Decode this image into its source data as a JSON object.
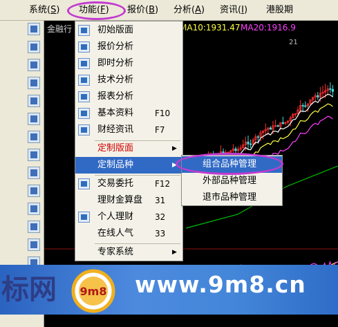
{
  "menubar": {
    "items": [
      {
        "label": "系统",
        "hotkey": "S"
      },
      {
        "label": "功能",
        "hotkey": "F"
      },
      {
        "label": "报价",
        "hotkey": "B"
      },
      {
        "label": "分析",
        "hotkey": "A"
      },
      {
        "label": "资讯",
        "hotkey": "I"
      },
      {
        "label": "港股期"
      }
    ]
  },
  "chart": {
    "stock_name": "金融行",
    "ma10": "MA10:1931.47",
    "ma20": "MA20:1916.9",
    "marker_label": "21",
    "colors": {
      "ma10": "#ffff40",
      "ma20": "#ff40ff",
      "up": "#ff3030",
      "down": "#40e0e0",
      "ma5": "#ffffff",
      "ma60": "#00c000"
    }
  },
  "menu": {
    "items": [
      {
        "label": "初始版面",
        "icon": "home-layout-icon"
      },
      {
        "label": "报价分析",
        "icon": "quote-list-icon"
      },
      {
        "label": "即时分析",
        "icon": "intraday-chart-icon"
      },
      {
        "label": "技术分析",
        "icon": "candlestick-icon"
      },
      {
        "label": "报表分析",
        "icon": "report-table-icon"
      },
      {
        "label": "基本资料",
        "shortcut": "F10",
        "icon": "profile-doc-icon"
      },
      {
        "label": "财经资讯",
        "shortcut": "F7",
        "icon": "news-icon"
      },
      {
        "label": "定制版面",
        "arrow": "▶"
      },
      {
        "label": "定制品种",
        "arrow": "▶"
      },
      {
        "label": "交易委托",
        "shortcut": "F12",
        "icon": "trade-users-icon"
      },
      {
        "label": "理财金算盘",
        "shortcut": "31"
      },
      {
        "label": "个人理财",
        "shortcut": "32",
        "icon": "finance-icon"
      },
      {
        "label": "在线人气",
        "shortcut": "33"
      },
      {
        "label": "专家系统",
        "arrow": "▶"
      }
    ]
  },
  "submenu": {
    "items": [
      {
        "label": "组合品种管理"
      },
      {
        "label": "外部品种管理"
      },
      {
        "label": "退市品种管理"
      }
    ]
  },
  "watermark": {
    "brand": "标网",
    "url": "www.9m8.cn",
    "logo_text": "9m8",
    "colors": {
      "banner": "#3f7fd6",
      "brand": "#2d3d86",
      "logo_ring": "#f0b020"
    }
  }
}
